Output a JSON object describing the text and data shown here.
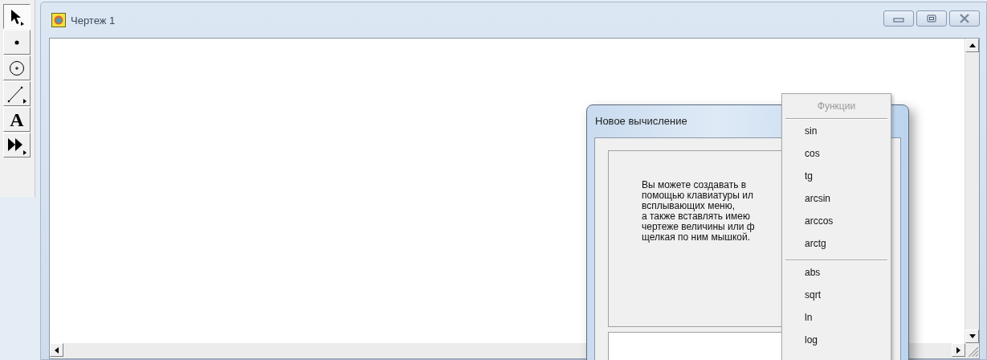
{
  "toolbar": {
    "tools": [
      {
        "kind": "arrow",
        "selected": true
      },
      {
        "kind": "point",
        "selected": false
      },
      {
        "kind": "circle",
        "selected": false
      },
      {
        "kind": "segment",
        "selected": false
      },
      {
        "kind": "text",
        "label": "A",
        "selected": false
      },
      {
        "kind": "more",
        "selected": false
      }
    ]
  },
  "window": {
    "title": "Чертеж 1"
  },
  "dialog": {
    "title": "Новое вычисление",
    "text_lines": [
      "Вы можете создавать в",
      "помощью клавиатуры ил",
      "всплывающих меню,",
      "а также вставлять имею",
      "чертеже величины или ф",
      "щелкая по ним мышкой."
    ]
  },
  "menu": {
    "header": {
      "label": "Функции",
      "disabled": true
    },
    "groups": [
      [
        {
          "label": "sin",
          "disabled": false
        },
        {
          "label": "cos",
          "disabled": false
        },
        {
          "label": "tg",
          "disabled": false
        },
        {
          "label": "arcsin",
          "disabled": false
        },
        {
          "label": "arccos",
          "disabled": false
        },
        {
          "label": "arctg",
          "disabled": false
        }
      ],
      [
        {
          "label": "abs",
          "disabled": false
        },
        {
          "label": "sqrt",
          "disabled": false
        },
        {
          "label": "ln",
          "disabled": false
        },
        {
          "label": "log",
          "disabled": false
        }
      ]
    ]
  }
}
